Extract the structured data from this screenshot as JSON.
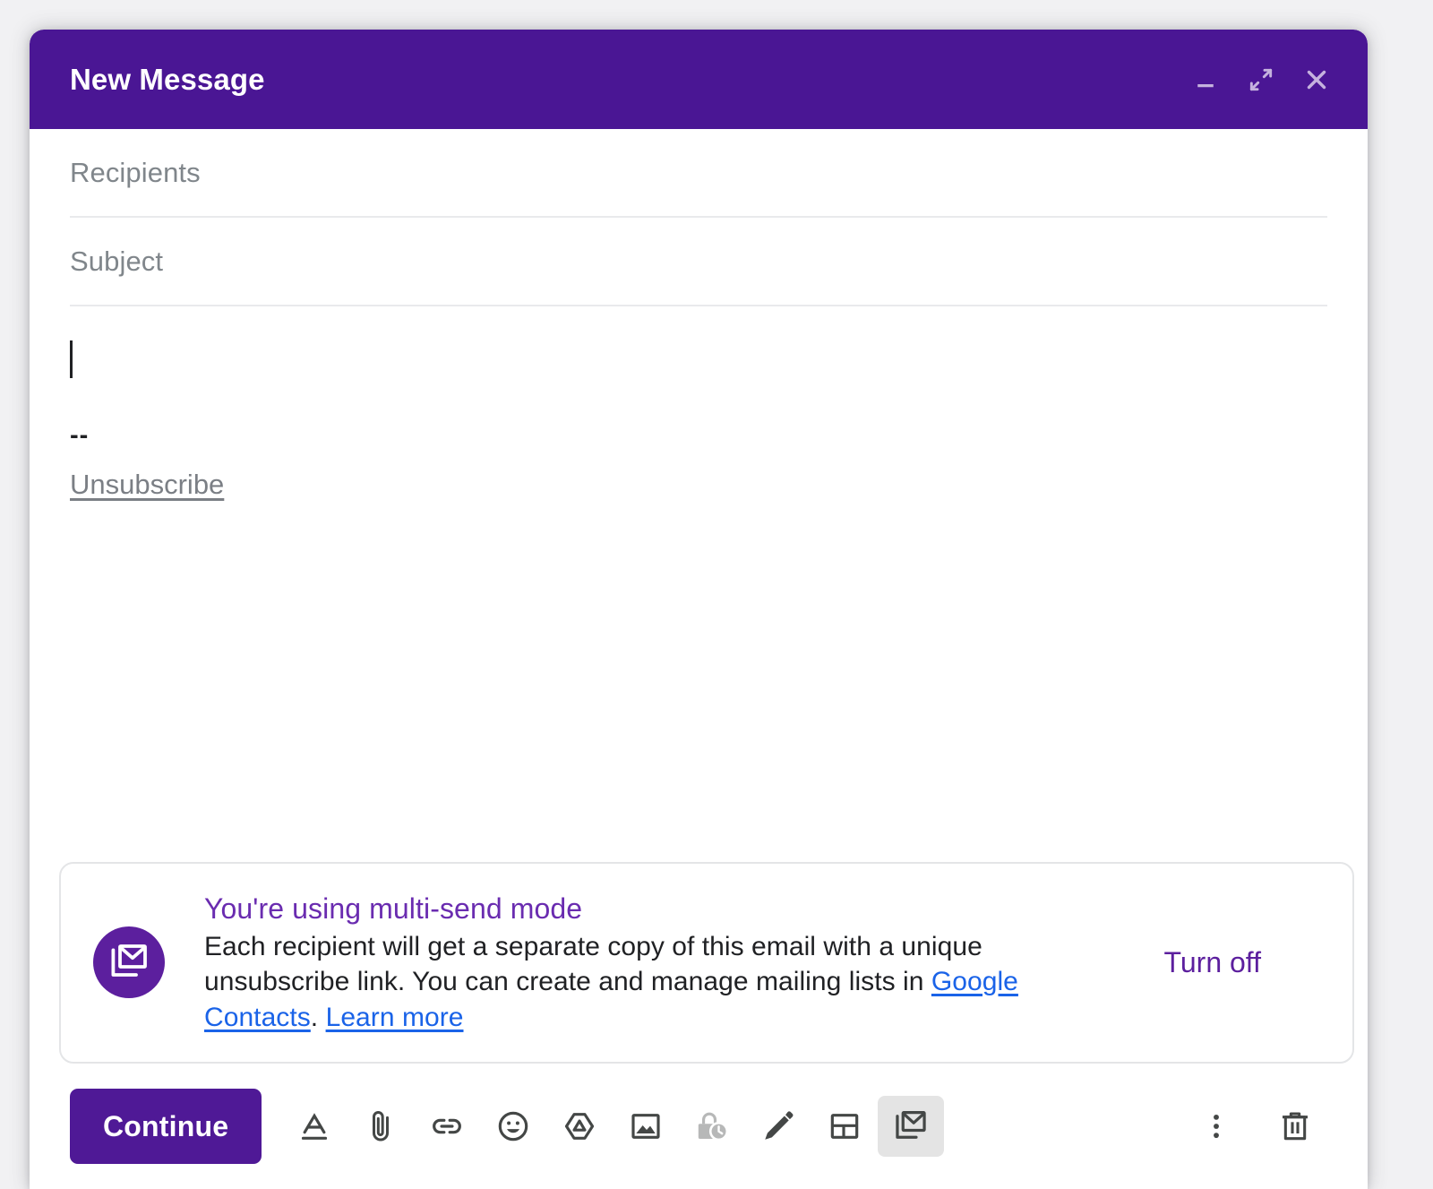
{
  "window": {
    "title": "New Message",
    "controls": [
      {
        "name": "minimize-button",
        "icon": "minimize-icon",
        "label": "Minimize"
      },
      {
        "name": "expand-button",
        "icon": "expand-icon",
        "label": "Expand"
      },
      {
        "name": "close-button",
        "icon": "close-icon",
        "label": "Close"
      }
    ]
  },
  "fields": {
    "recipients": {
      "placeholder": "Recipients",
      "value": ""
    },
    "subject": {
      "placeholder": "Subject",
      "value": ""
    }
  },
  "body": {
    "content": "",
    "signature_separator": "--",
    "unsubscribe_label": "Unsubscribe"
  },
  "multisend_card": {
    "icon": "multi-send-icon",
    "heading": "You're using multi-send mode",
    "body_part1": "Each recipient will get a separate copy of this email with a unique unsubscribe link. You can create and manage mailing lists in ",
    "link_contacts": "Google Contacts",
    "body_part2": ". ",
    "link_learn_more": "Learn more",
    "turn_off_label": "Turn off"
  },
  "toolbar": {
    "continue_label": "Continue",
    "icons": [
      {
        "name": "formatting-options-icon",
        "label": "Formatting options",
        "state": "normal"
      },
      {
        "name": "attach-file-icon",
        "label": "Attach files",
        "state": "normal"
      },
      {
        "name": "insert-link-icon",
        "label": "Insert link",
        "state": "normal"
      },
      {
        "name": "insert-emoji-icon",
        "label": "Insert emoji",
        "state": "normal"
      },
      {
        "name": "insert-drive-file-icon",
        "label": "Insert files using Drive",
        "state": "normal"
      },
      {
        "name": "insert-photo-icon",
        "label": "Insert photo",
        "state": "normal"
      },
      {
        "name": "confidential-mode-icon",
        "label": "Toggle confidential mode",
        "state": "disabled"
      },
      {
        "name": "insert-signature-icon",
        "label": "Insert signature",
        "state": "normal"
      },
      {
        "name": "insert-template-icon",
        "label": "Templates",
        "state": "normal"
      },
      {
        "name": "multi-send-toggle-icon",
        "label": "Multi-send mode",
        "state": "active"
      }
    ],
    "more_options_label": "More options",
    "discard_label": "Discard draft"
  },
  "colors": {
    "header_purple": "#4a1694",
    "button_purple": "#4f1996",
    "accent_purple": "#6a2cb0",
    "icon_purple": "#5c1f9e",
    "link_blue": "#1a63e8",
    "placeholder_gray": "#80868b",
    "icon_gray": "#444746",
    "page_background": "#f1f1f3"
  }
}
